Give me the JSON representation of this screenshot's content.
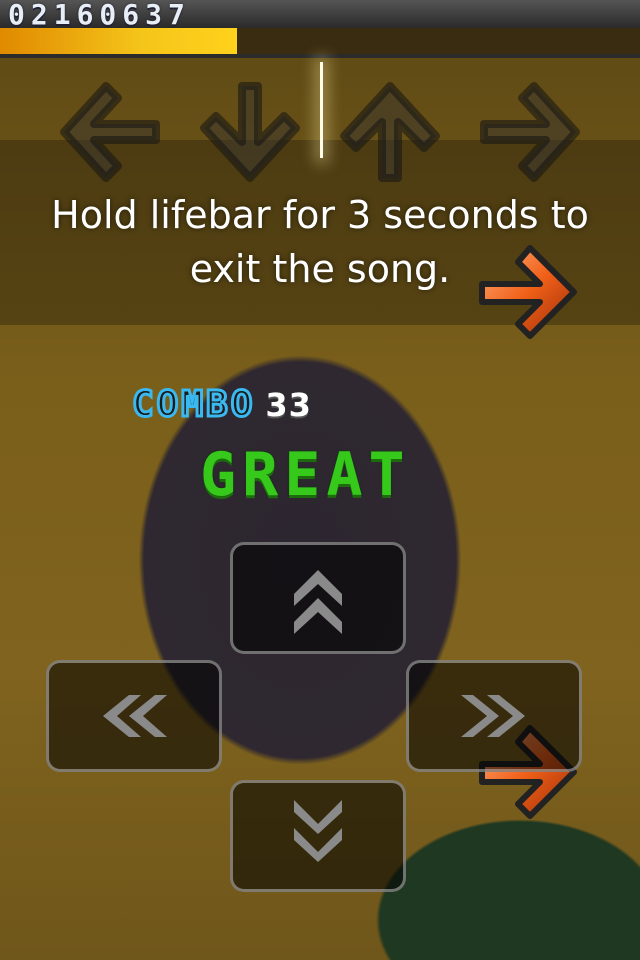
{
  "hud": {
    "score": "02160637",
    "life": {
      "level_fraction": 0.37,
      "color": "#f2b814"
    }
  },
  "hint": {
    "line1": "Hold lifebar for 3 seconds to",
    "line2": "exit the song."
  },
  "receptors": [
    {
      "direction": "left",
      "icon": "left-arrow-icon"
    },
    {
      "direction": "down",
      "icon": "down-arrow-icon"
    },
    {
      "direction": "up",
      "icon": "up-arrow-icon"
    },
    {
      "direction": "right",
      "icon": "right-arrow-icon"
    }
  ],
  "notes": [
    {
      "lane": "right",
      "color": "#f06018"
    },
    {
      "lane": "right",
      "color": "#f06018"
    }
  ],
  "combo": {
    "label": "COMBO",
    "count": "33"
  },
  "judgment": {
    "text": "GREAT",
    "color": "#36c91c"
  },
  "touch_pad": [
    {
      "direction": "up",
      "icon": "double-chevron-up-icon"
    },
    {
      "direction": "left",
      "icon": "double-chevron-left-icon"
    },
    {
      "direction": "right",
      "icon": "double-chevron-right-icon"
    },
    {
      "direction": "down",
      "icon": "double-chevron-down-icon"
    }
  ],
  "colors": {
    "accent": "#3ab8f0",
    "note": "#f06018"
  }
}
